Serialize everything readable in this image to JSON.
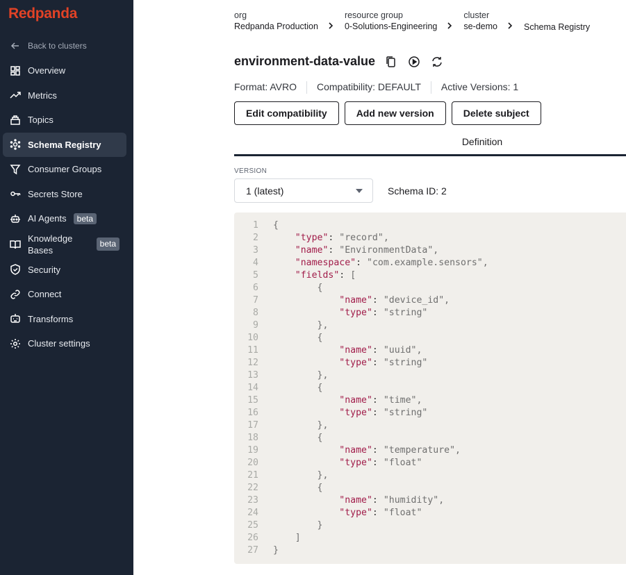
{
  "sidebar": {
    "logo": "Redpanda",
    "back": "Back to clusters",
    "items": [
      {
        "label": "Overview",
        "icon": "grid-icon"
      },
      {
        "label": "Metrics",
        "icon": "trend-icon"
      },
      {
        "label": "Topics",
        "icon": "topics-icon"
      },
      {
        "label": "Schema Registry",
        "icon": "schema-icon",
        "active": true
      },
      {
        "label": "Consumer Groups",
        "icon": "filter-icon"
      },
      {
        "label": "Secrets Store",
        "icon": "key-icon"
      },
      {
        "label": "AI Agents",
        "icon": "robot-icon",
        "badge": "beta"
      },
      {
        "label": "Knowledge Bases",
        "icon": "book-icon",
        "badge": "beta"
      },
      {
        "label": "Security",
        "icon": "shield-icon"
      },
      {
        "label": "Connect",
        "icon": "link-icon"
      },
      {
        "label": "Transforms",
        "icon": "transform-icon"
      },
      {
        "label": "Cluster settings",
        "icon": "gear-icon"
      }
    ]
  },
  "breadcrumb": {
    "org_label": "org",
    "org": "Redpanda Production",
    "rg_label": "resource group",
    "rg": "0-Solutions-Engineering",
    "cluster_label": "cluster",
    "cluster": "se-demo",
    "current": "Schema Registry"
  },
  "subject": {
    "title": "environment-data-value",
    "format": "Format:  AVRO",
    "compatibility": "Compatibility:  DEFAULT",
    "active_versions": "Active Versions:  1"
  },
  "actions": {
    "edit": "Edit compatibility",
    "add": "Add new version",
    "delete": "Delete subject"
  },
  "tab": "Definition",
  "version": {
    "label": "VERSION",
    "selected": "1 (latest)",
    "schema_id": "Schema ID: 2"
  },
  "code_lines": [
    "{",
    "    \"type\": \"record\",",
    "    \"name\": \"EnvironmentData\",",
    "    \"namespace\": \"com.example.sensors\",",
    "    \"fields\": [",
    "        {",
    "            \"name\": \"device_id\",",
    "            \"type\": \"string\"",
    "        },",
    "        {",
    "            \"name\": \"uuid\",",
    "            \"type\": \"string\"",
    "        },",
    "        {",
    "            \"name\": \"time\",",
    "            \"type\": \"string\"",
    "        },",
    "        {",
    "            \"name\": \"temperature\",",
    "            \"type\": \"float\"",
    "        },",
    "        {",
    "            \"name\": \"humidity\",",
    "            \"type\": \"float\"",
    "        }",
    "    ]",
    "}"
  ]
}
